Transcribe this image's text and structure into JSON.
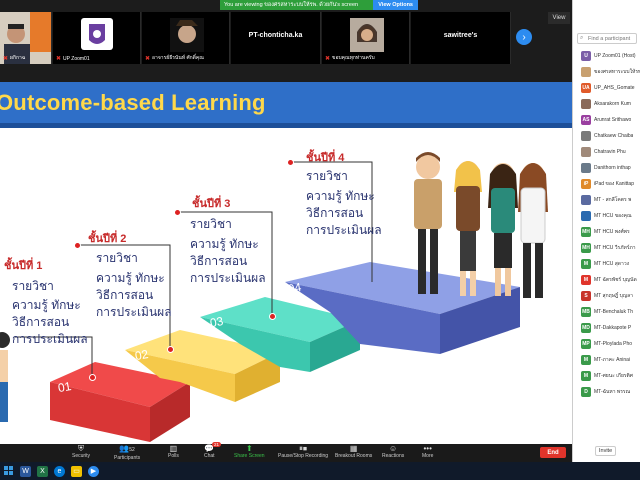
{
  "banner": {
    "text": "You are viewing ของศรสหาระบบให้รพ. ด้วยกัน's screen",
    "view_options": "View Options"
  },
  "view_button": "View",
  "gallery": {
    "tiles": [
      {
        "name": "ผกิกาฉ",
        "bg": "#d8d0c8"
      },
      {
        "name": "UP Zoom01",
        "bg": "#ffffff"
      },
      {
        "name": "อาจารย์ธีรนันท์ ศักดิ์คุณ",
        "bg": "#222222"
      },
      {
        "name": "PT-chonticha.ka",
        "center": true
      },
      {
        "name": "ขอบคุณทุกท่านครับ",
        "bg": "#9a8f86"
      },
      {
        "name": "sawitree's",
        "center": true
      }
    ]
  },
  "slide": {
    "title": "Outcome-based Learning",
    "steps": [
      {
        "label": "ชั้นปีที่ 1",
        "subject": "รายวิชา",
        "lines": [
          "ความรู้ ทักษะ",
          "วิธีการสอน",
          "การประเมินผล"
        ],
        "number": "01"
      },
      {
        "label": "ชั้นปีที่ 2",
        "subject": "รายวิชา",
        "lines": [
          "ความรู้ ทักษะ",
          "วิธีการสอน",
          "การประเมินผล"
        ],
        "number": "02"
      },
      {
        "label": "ชั้นปีที่ 3",
        "subject": "รายวิชา",
        "lines": [
          "ความรู้ ทักษะ",
          "วิธีการสอน",
          "การประเมินผล"
        ],
        "number": "03"
      },
      {
        "label": "ชั้นปีที่ 4",
        "subject": "รายวิชา",
        "lines": [
          "ความรู้ ทักษะ",
          "วิธีการสอน",
          "การประเมินผล"
        ],
        "number": "04"
      }
    ]
  },
  "toolbar": {
    "security": "Security",
    "participants": "Participants",
    "participants_count": "52",
    "polls": "Polls",
    "chat": "Chat",
    "chat_badge": "21",
    "share_screen": "Share Screen",
    "recording": "Pause/Stop Recording",
    "breakout": "Breakout Rooms",
    "reactions": "Reactions",
    "more": "More",
    "end": "End"
  },
  "panel": {
    "search_placeholder": "Find a participant",
    "participants": [
      {
        "name": "UP Zoom01 (Host)",
        "color": "#7b5ea7",
        "initials": "U"
      },
      {
        "name": "ของศรสหาระบบให้รพ.",
        "color": "#c8a070",
        "initials": ""
      },
      {
        "name": "UP_AHS_Gomate",
        "color": "#e05a2a",
        "initials": "UA"
      },
      {
        "name": "Aksarakorn Kum",
        "color": "#8a6a5a",
        "initials": ""
      },
      {
        "name": "Arunrat Srithawo",
        "color": "#9a3fa0",
        "initials": "AS"
      },
      {
        "name": "Chatkaew Chaiba",
        "color": "#7a7a7a",
        "initials": ""
      },
      {
        "name": "Chatravin Phu",
        "color": "#a08a7a",
        "initials": ""
      },
      {
        "name": "Danithorn inthap",
        "color": "#6a7a8a",
        "initials": ""
      },
      {
        "name": "iPad ของ Kanittap",
        "color": "#e08a2a",
        "initials": "iP"
      },
      {
        "name": "MT - สกลีโคตร พ",
        "color": "#5a6aa0",
        "initials": ""
      },
      {
        "name": "MT HCU ของคุณ",
        "color": "#2a6ab0",
        "initials": ""
      },
      {
        "name": "MT HCU พงศ์พร",
        "color": "#3a9a4a",
        "initials": "MH"
      },
      {
        "name": "MT HCU วีรภัทร์ภา",
        "color": "#3a9a4a",
        "initials": "MH"
      },
      {
        "name": "MT HCU สุดาวง",
        "color": "#3a9a4a",
        "initials": "M"
      },
      {
        "name": "MT ฉัตรพัชร์ บุญนัด",
        "color": "#e0342b",
        "initials": "M"
      },
      {
        "name": "MT สุกฤษฎิ์ บุญลา",
        "color": "#c8342b",
        "initials": "S"
      },
      {
        "name": "MT-Benchaluk Th",
        "color": "#3a9a4a",
        "initials": "MB"
      },
      {
        "name": "MT-Dakkapote P",
        "color": "#3a9a4a",
        "initials": "MD"
      },
      {
        "name": "MT-Ploylada Pho",
        "color": "#3a9a4a",
        "initials": "MP"
      },
      {
        "name": "MT-ภาคะ Aninai",
        "color": "#3a9a4a",
        "initials": "M"
      },
      {
        "name": "MT-ศยนะ เกียรติศ",
        "color": "#3a9a4a",
        "initials": "M"
      },
      {
        "name": "MT-ฉันหา พรรณ",
        "color": "#3a9a4a",
        "initials": "D"
      }
    ],
    "invite": "Invite"
  }
}
